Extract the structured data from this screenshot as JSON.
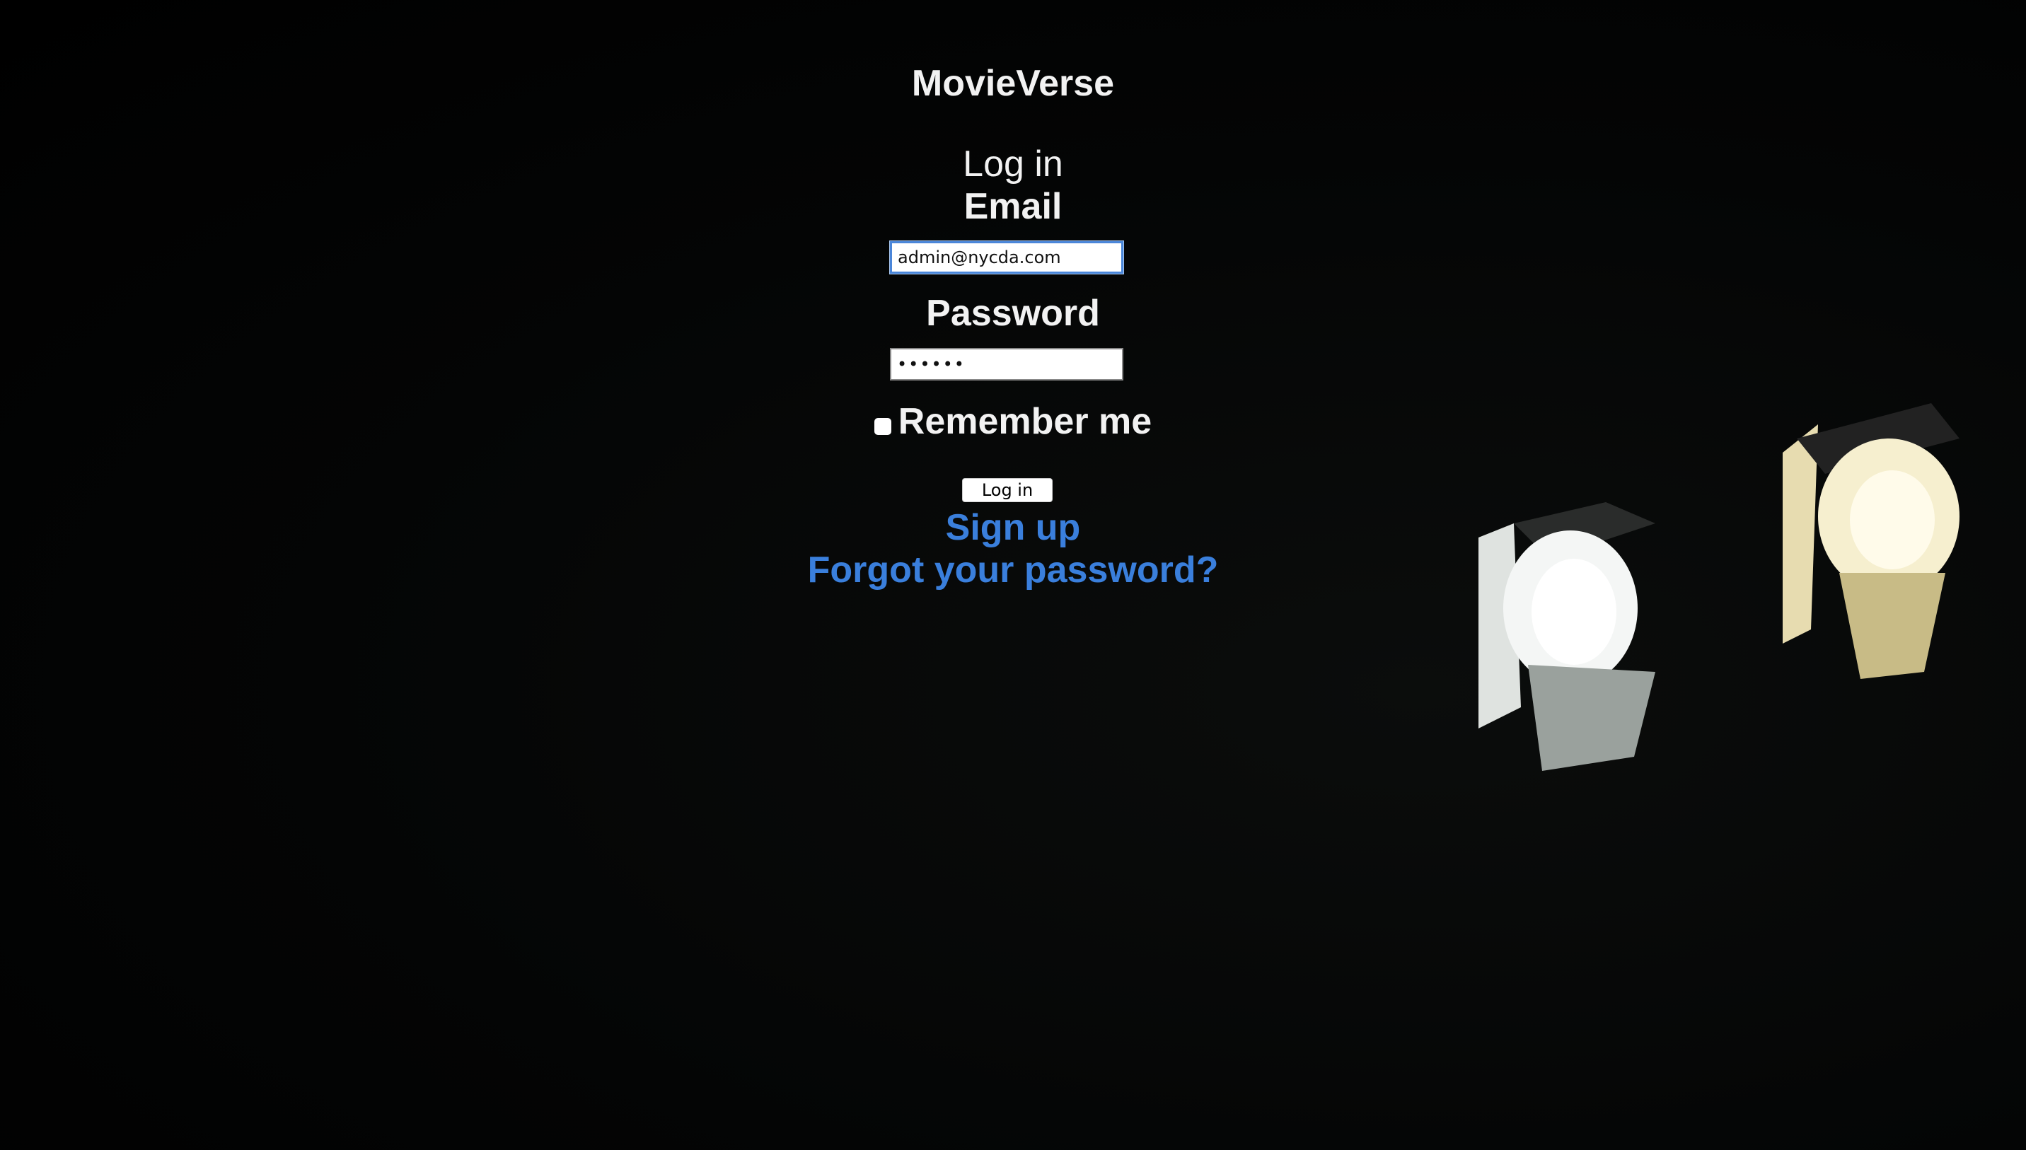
{
  "app": {
    "brand": "MovieVerse"
  },
  "form": {
    "heading": "Log in",
    "email_label": "Email",
    "email_value": "admin@nycda.com",
    "password_label": "Password",
    "password_value": "••••••",
    "remember_label": "Remember me",
    "remember_checked": false,
    "submit_label": "Log in"
  },
  "links": {
    "signup": "Sign up",
    "forgot": "Forgot your password?"
  },
  "colors": {
    "background": "#000000",
    "text": "#f2f2f2",
    "link": "#3a7fdc",
    "focus": "#4a86d9"
  },
  "background_icons": [
    "stage-light-icon",
    "stage-light-icon"
  ]
}
